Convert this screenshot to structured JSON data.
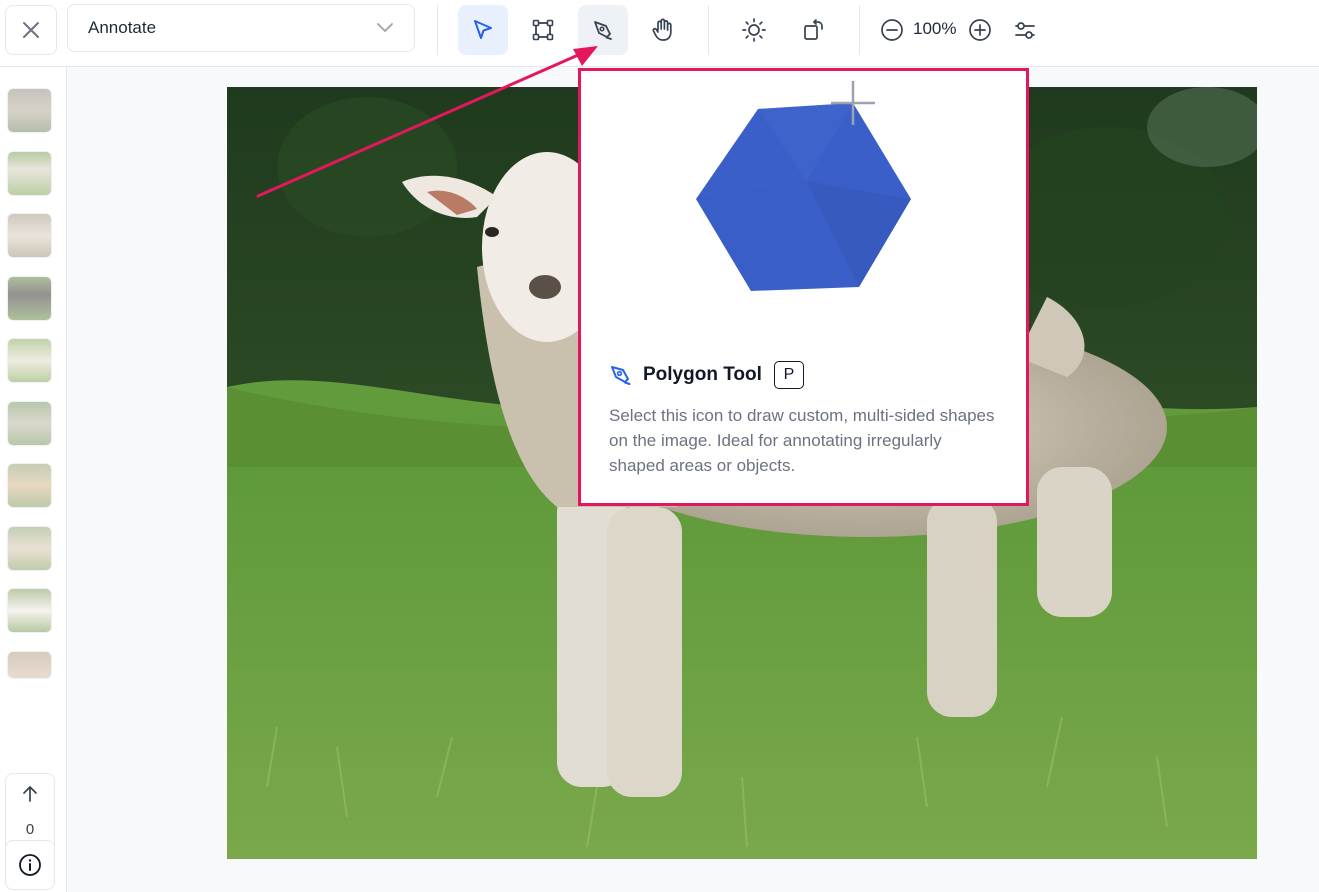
{
  "toolbar": {
    "mode_label": "Annotate",
    "zoom_label": "100%",
    "tools": [
      {
        "name": "select-tool",
        "icon": "pointer-arrow-icon",
        "active": true
      },
      {
        "name": "bounding-box-tool",
        "icon": "bounding-box-icon",
        "active": false
      },
      {
        "name": "polygon-tool",
        "icon": "pen-nib-icon",
        "active": false
      },
      {
        "name": "pan-tool",
        "icon": "hand-icon",
        "active": false
      }
    ],
    "image_tools": [
      "brightness-icon",
      "rotate-icon"
    ],
    "zoom_tools": [
      "zoom-out-icon",
      "zoom-in-icon",
      "settings-sliders-icon"
    ]
  },
  "sidebar": {
    "thumbnail_count": 10,
    "page_index": "0"
  },
  "tooltip": {
    "title": "Polygon Tool",
    "shortcut": "P",
    "description": "Select this icon to draw custom, multi-sided shapes on the image. Ideal for annotating irregularly shaped areas or objects."
  },
  "colors": {
    "accent": "#2563eb",
    "highlight_border": "#e5175c",
    "polygon_fill": "#3b5fc8",
    "active_tool_bg": "#e8effd"
  }
}
